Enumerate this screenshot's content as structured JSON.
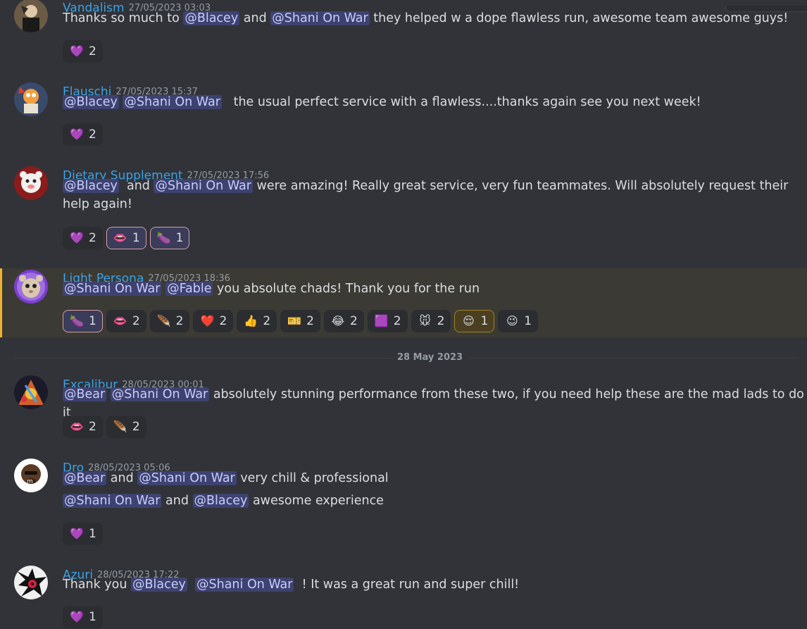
{
  "date_divider": "28 May 2023",
  "messages": [
    {
      "author": "Vandalism",
      "timestamp": "27/05/2023 03:03",
      "lines": [
        [
          {
            "t": "Thanks so much to "
          },
          {
            "m": "@Blacey"
          },
          {
            "t": " and "
          },
          {
            "m": "@Shani On War"
          },
          {
            "t": " they helped w a dope flawless run, awesome team awesome guys!"
          }
        ]
      ],
      "reactions": [
        {
          "emoji": "💜",
          "count": "2"
        }
      ]
    },
    {
      "author": "Flauschi",
      "timestamp": "27/05/2023 15:37",
      "lines": [
        [
          {
            "m": "@Blacey"
          },
          {
            "t": " "
          },
          {
            "m": "@Shani On War"
          },
          {
            "t": "   the usual perfect service with a flawless....thanks again see you next week!"
          }
        ]
      ],
      "reactions": [
        {
          "emoji": "💜",
          "count": "2"
        }
      ]
    },
    {
      "author": "Dietary Supplement",
      "timestamp": "27/05/2023 17:56",
      "lines": [
        [
          {
            "m": "@Blacey"
          },
          {
            "t": "  and "
          },
          {
            "m": "@Shani On War"
          },
          {
            "t": " were amazing! Really great service, very fun teammates. Will absolutely request their help again!"
          }
        ]
      ],
      "reactions": [
        {
          "emoji": "💜",
          "count": "2"
        },
        {
          "emoji": "👄",
          "count": "1",
          "me": true
        },
        {
          "emoji": "🍆",
          "count": "1",
          "me": true
        }
      ]
    },
    {
      "author": "Light Persona",
      "timestamp": "27/05/2023 18:36",
      "lines": [
        [
          {
            "m": "@Shani On War"
          },
          {
            "t": " "
          },
          {
            "m": "@Fable"
          },
          {
            "t": " you absolute chads! Thank you for the run"
          }
        ]
      ],
      "reactions": [
        {
          "emoji": "🍆",
          "count": "1",
          "me": true
        },
        {
          "emoji": "👄",
          "count": "2"
        },
        {
          "emoji": "🪶",
          "count": "2"
        },
        {
          "emoji": "❤️",
          "count": "2"
        },
        {
          "emoji": "👍",
          "count": "2"
        },
        {
          "emoji": "🎫",
          "count": "2"
        },
        {
          "emoji": "😂",
          "count": "2"
        },
        {
          "emoji": "🟪",
          "count": "2"
        },
        {
          "emoji": "🐭",
          "count": "2"
        },
        {
          "emoji": "😌",
          "count": "1",
          "gold": true
        },
        {
          "emoji": "😉",
          "count": "1"
        }
      ]
    },
    {
      "author": "Excalibur",
      "timestamp": "28/05/2023 00:01",
      "lines": [
        [
          {
            "m": "@Bear"
          },
          {
            "t": " "
          },
          {
            "m": "@Shani On War"
          },
          {
            "t": " absolutely stunning performance from these two, if you need help these are the mad lads to do it"
          }
        ]
      ],
      "reactions": [
        {
          "emoji": "👄",
          "count": "2"
        },
        {
          "emoji": "🪶",
          "count": "2"
        }
      ]
    },
    {
      "author": "Dro",
      "timestamp": "28/05/2023 05:06",
      "lines": [
        [
          {
            "m": "@Bear"
          },
          {
            "t": " and "
          },
          {
            "m": "@Shani On War"
          },
          {
            "t": " very chill & professional"
          }
        ],
        [
          {
            "m": "@Shani On War"
          },
          {
            "t": " and "
          },
          {
            "m": "@Blacey"
          },
          {
            "t": " awesome experience"
          }
        ]
      ],
      "reactions": [
        {
          "emoji": "💜",
          "count": "1"
        }
      ]
    },
    {
      "author": "Azuri",
      "timestamp": "28/05/2023 17:22",
      "lines": [
        [
          {
            "t": "Thank you "
          },
          {
            "m": "@Blacey"
          },
          {
            "t": "  "
          },
          {
            "m": "@Shani On War"
          },
          {
            "t": "  ! It was a great run and super chill!"
          }
        ]
      ],
      "reactions": [
        {
          "emoji": "💜",
          "count": "1"
        }
      ]
    }
  ]
}
